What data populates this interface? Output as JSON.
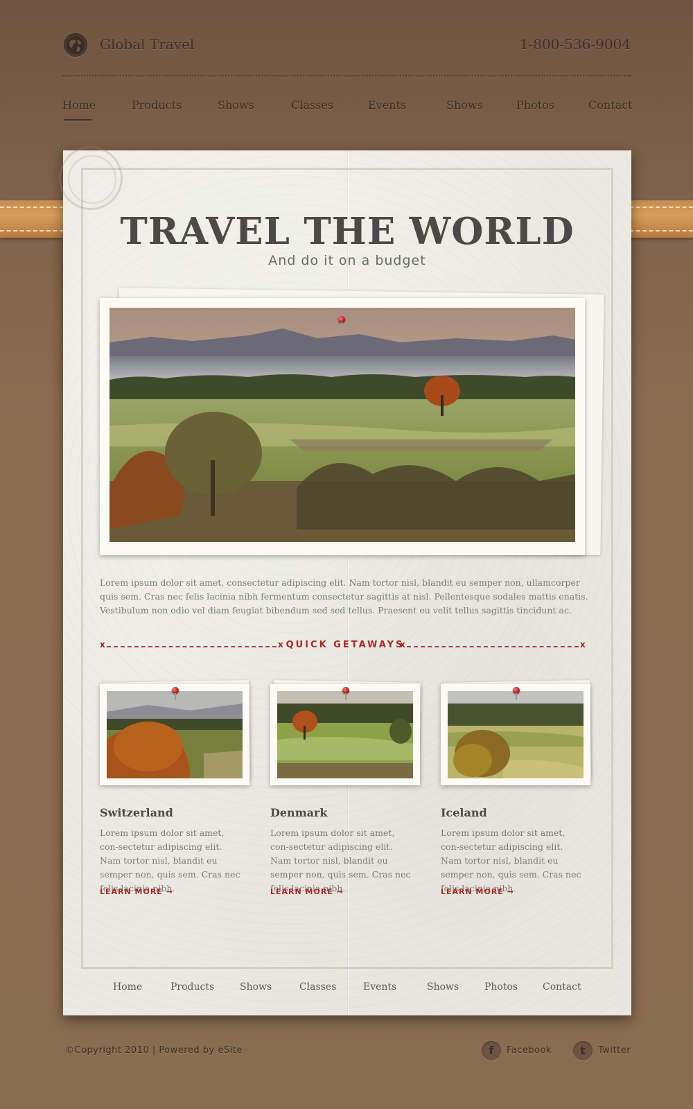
{
  "brand": {
    "name": "Global Travel",
    "icon": "globe-icon"
  },
  "phone": "1-800-536-9004",
  "top_nav": [
    "Home",
    "Products",
    "Shows",
    "Classes",
    "Events",
    "Shows",
    "Photos",
    "Contact"
  ],
  "hero": {
    "title": "TRAVEL THE WORLD",
    "subtitle": "And do it on a budget"
  },
  "intro": "Lorem ipsum dolor sit amet, consectetur adipiscing elit. Nam tortor nisl, blandit eu semper non, ullamcorper quis sem. Cras nec felis lacinia nibh fermentum consectetur sagittis at nisl. Pellentesque sodales mattis enatis. Vestibulum non odio vel diam feugiat bibendum sed sed tellus. Praesent eu velit tellus sagittis tincidunt ac.",
  "getaways": {
    "label": "QUICK GETAWAYS",
    "marker": "x",
    "items": [
      {
        "title": "Switzerland",
        "text": "Lorem ipsum dolor sit amet, con-sectetur adipiscing elit. Nam tortor nisl, blandit eu semper non, quis sem. Cras nec felis lacinia nibh.",
        "link": "LEARN MORE →"
      },
      {
        "title": "Denmark",
        "text": "Lorem ipsum dolor sit amet, con-sectetur adipiscing elit. Nam tortor nisl, blandit eu semper non, quis sem. Cras nec felis lacinia nibh.",
        "link": "LEARN MORE →"
      },
      {
        "title": "Iceland",
        "text": "Lorem ipsum dolor sit amet, con-sectetur adipiscing elit. Nam tortor nisl, blandit eu semper non, quis sem. Cras nec felis lacinia nibh.",
        "link": "LEARN MORE →"
      }
    ]
  },
  "footer_nav": [
    "Home",
    "Products",
    "Shows",
    "Classes",
    "Events",
    "Shows",
    "Photos",
    "Contact"
  ],
  "copyright": "©Copyright 2010 | Powered by eSite",
  "social": [
    {
      "label": "Facebook",
      "icon": "facebook-icon",
      "glyph": "f"
    },
    {
      "label": "Twitter",
      "icon": "twitter-icon",
      "glyph": "t"
    }
  ],
  "colors": {
    "background": "#8a6a4f",
    "paper": "#ebeae2",
    "accent_red": "#a22a2a",
    "strap": "#d09554",
    "header_text": "#3d2f26"
  }
}
